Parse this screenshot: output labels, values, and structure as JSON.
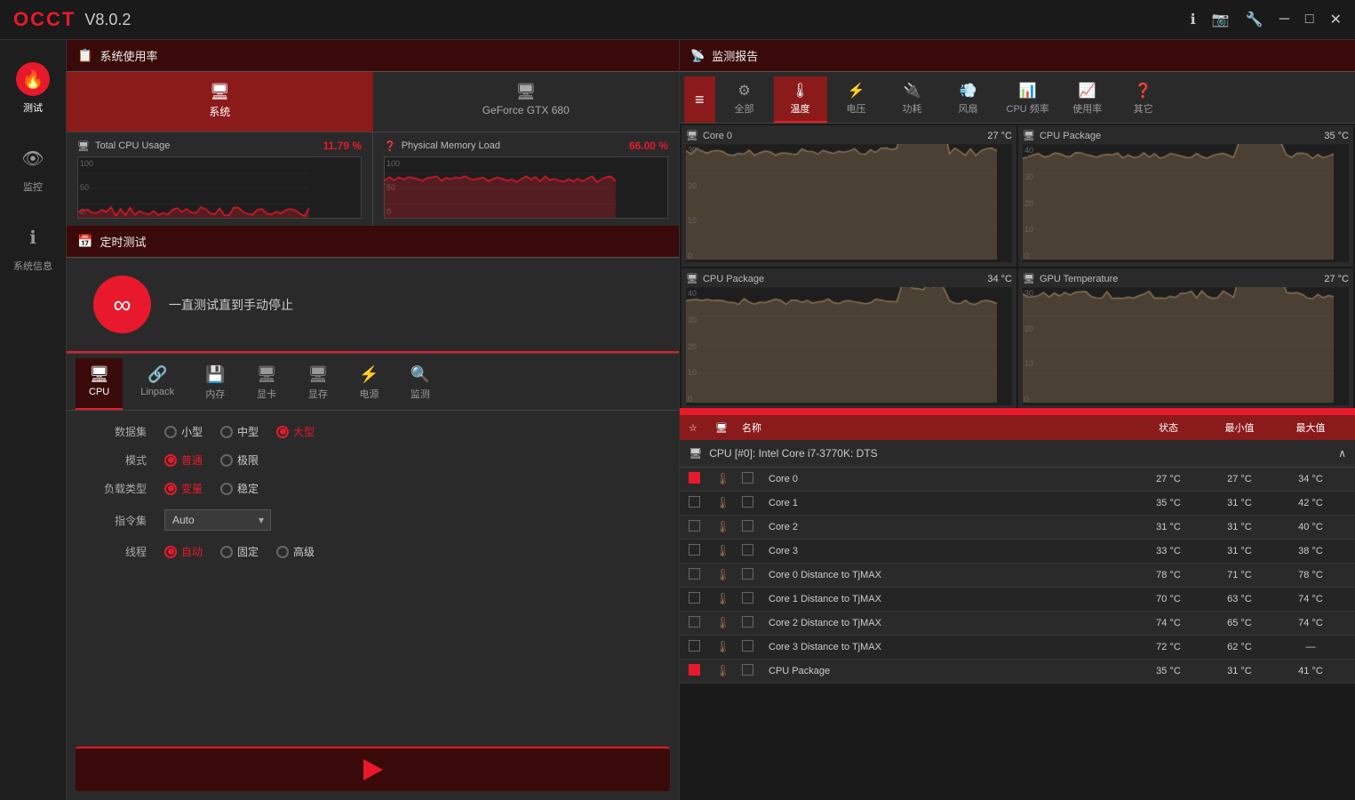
{
  "titlebar": {
    "logo": "OCCT",
    "version": "V8.0.2",
    "controls": {
      "info": "ℹ",
      "camera": "📷",
      "settings": "🔧",
      "minimize": "─",
      "maximize": "□",
      "close": "✕"
    }
  },
  "sidebar": {
    "items": [
      {
        "icon": "🔥",
        "label": "测试",
        "active": true
      },
      {
        "icon": "👁",
        "label": "监控",
        "active": false
      },
      {
        "icon": "ℹ",
        "label": "系统信息",
        "active": false
      }
    ]
  },
  "system_usage": {
    "title": "系统使用率",
    "tabs": [
      {
        "label": "系统",
        "icon": "🖥",
        "active": true
      },
      {
        "label": "GeForce GTX 680",
        "icon": "🖥",
        "active": false
      }
    ],
    "stats": {
      "cpu": {
        "label": "Total CPU Usage",
        "value": "11.79 %",
        "chart_levels": [
          100,
          50,
          0
        ]
      },
      "memory": {
        "label": "Physical Memory Load",
        "value": "66.00 %",
        "chart_levels": [
          100,
          50,
          0
        ]
      }
    }
  },
  "scheduled_test": {
    "title": "定时测试",
    "description": "一直测试直到手动停止"
  },
  "test_tabs": [
    {
      "icon": "🖥",
      "label": "CPU",
      "active": true
    },
    {
      "icon": "🔗",
      "label": "Linpack",
      "active": false
    },
    {
      "icon": "💾",
      "label": "内存",
      "active": false
    },
    {
      "icon": "🖥",
      "label": "显卡",
      "active": false
    },
    {
      "icon": "🖥",
      "label": "显存",
      "active": false
    },
    {
      "icon": "⚡",
      "label": "电源",
      "active": false
    },
    {
      "icon": "🔍",
      "label": "监测",
      "active": false
    }
  ],
  "test_settings": {
    "dataset": {
      "label": "数据集",
      "options": [
        {
          "value": "small",
          "label": "小型",
          "checked": false
        },
        {
          "value": "medium",
          "label": "中型",
          "checked": false
        },
        {
          "value": "large",
          "label": "大型",
          "checked": true
        }
      ]
    },
    "mode": {
      "label": "模式",
      "options": [
        {
          "value": "normal",
          "label": "普通",
          "checked": true
        },
        {
          "value": "extreme",
          "label": "极限",
          "checked": false
        }
      ]
    },
    "load_type": {
      "label": "负载类型",
      "options": [
        {
          "value": "variable",
          "label": "变量",
          "checked": true
        },
        {
          "value": "stable",
          "label": "稳定",
          "checked": false
        }
      ]
    },
    "instruction": {
      "label": "指令集",
      "value": "Auto"
    },
    "threads": {
      "label": "线程",
      "options": [
        {
          "value": "auto",
          "label": "自动",
          "checked": true
        },
        {
          "value": "fixed",
          "label": "固定",
          "checked": false
        },
        {
          "value": "advanced",
          "label": "高级",
          "checked": false
        }
      ]
    }
  },
  "monitor": {
    "title": "监测报告",
    "tabs": [
      {
        "icon": "≡",
        "label": "",
        "active": false,
        "menu": true
      },
      {
        "icon": "⚙",
        "label": "全部",
        "active": false
      },
      {
        "icon": "🌡",
        "label": "温度",
        "active": true
      },
      {
        "icon": "⚡",
        "label": "电压",
        "active": false
      },
      {
        "icon": "🔌",
        "label": "功耗",
        "active": false
      },
      {
        "icon": "💨",
        "label": "风扇",
        "active": false
      },
      {
        "icon": "📊",
        "label": "CPU 频率",
        "active": false
      },
      {
        "icon": "📈",
        "label": "使用率",
        "active": false
      },
      {
        "icon": "❓",
        "label": "其它",
        "active": false
      }
    ],
    "charts": [
      {
        "title": "Core 0",
        "value": "27 °C",
        "y_max": 30,
        "y_labels": [
          "30",
          "20",
          "10",
          "0"
        ],
        "color": "#8b7355"
      },
      {
        "title": "CPU Package",
        "value": "35 °C",
        "y_max": 40,
        "y_labels": [
          "40",
          "30",
          "20",
          "10",
          "0"
        ],
        "color": "#8b7355"
      },
      {
        "title": "CPU Package",
        "value": "34 °C",
        "y_max": 40,
        "y_labels": [
          "40",
          "30",
          "20",
          "10",
          "0"
        ],
        "color": "#8b7355"
      },
      {
        "title": "GPU Temperature",
        "value": "27 °C",
        "y_max": 30,
        "y_labels": [
          "30",
          "20",
          "10",
          "0"
        ],
        "color": "#8b7355"
      }
    ],
    "table_header": {
      "fav": "☆",
      "icon": "🖥",
      "name": "名称",
      "status": "状态",
      "min": "最小值",
      "max": "最大值"
    },
    "group": {
      "title": "CPU [#0]: Intel Core i7-3770K: DTS"
    },
    "rows": [
      {
        "checked": true,
        "name": "Core 0",
        "status": "27 °C",
        "min": "27 °C",
        "max": "34 °C"
      },
      {
        "checked": false,
        "name": "Core 1",
        "status": "35 °C",
        "min": "31 °C",
        "max": "42 °C"
      },
      {
        "checked": false,
        "name": "Core 2",
        "status": "31 °C",
        "min": "31 °C",
        "max": "40 °C"
      },
      {
        "checked": false,
        "name": "Core 3",
        "status": "33 °C",
        "min": "31 °C",
        "max": "38 °C"
      },
      {
        "checked": false,
        "name": "Core 0 Distance to TjMAX",
        "status": "78 °C",
        "min": "71 °C",
        "max": "78 °C"
      },
      {
        "checked": false,
        "name": "Core 1 Distance to TjMAX",
        "status": "70 °C",
        "min": "63 °C",
        "max": "74 °C"
      },
      {
        "checked": false,
        "name": "Core 2 Distance to TjMAX",
        "status": "74 °C",
        "min": "65 °C",
        "max": "74 °C"
      },
      {
        "checked": false,
        "name": "Core 3 Distance to TjMAX",
        "status": "72 °C",
        "min": "62 °C",
        "max": "..."
      },
      {
        "checked": true,
        "name": "CPU Package",
        "status": "35 °C",
        "min": "31 °C",
        "max": "41 °C"
      }
    ]
  },
  "start_button": {
    "label": "▶"
  }
}
